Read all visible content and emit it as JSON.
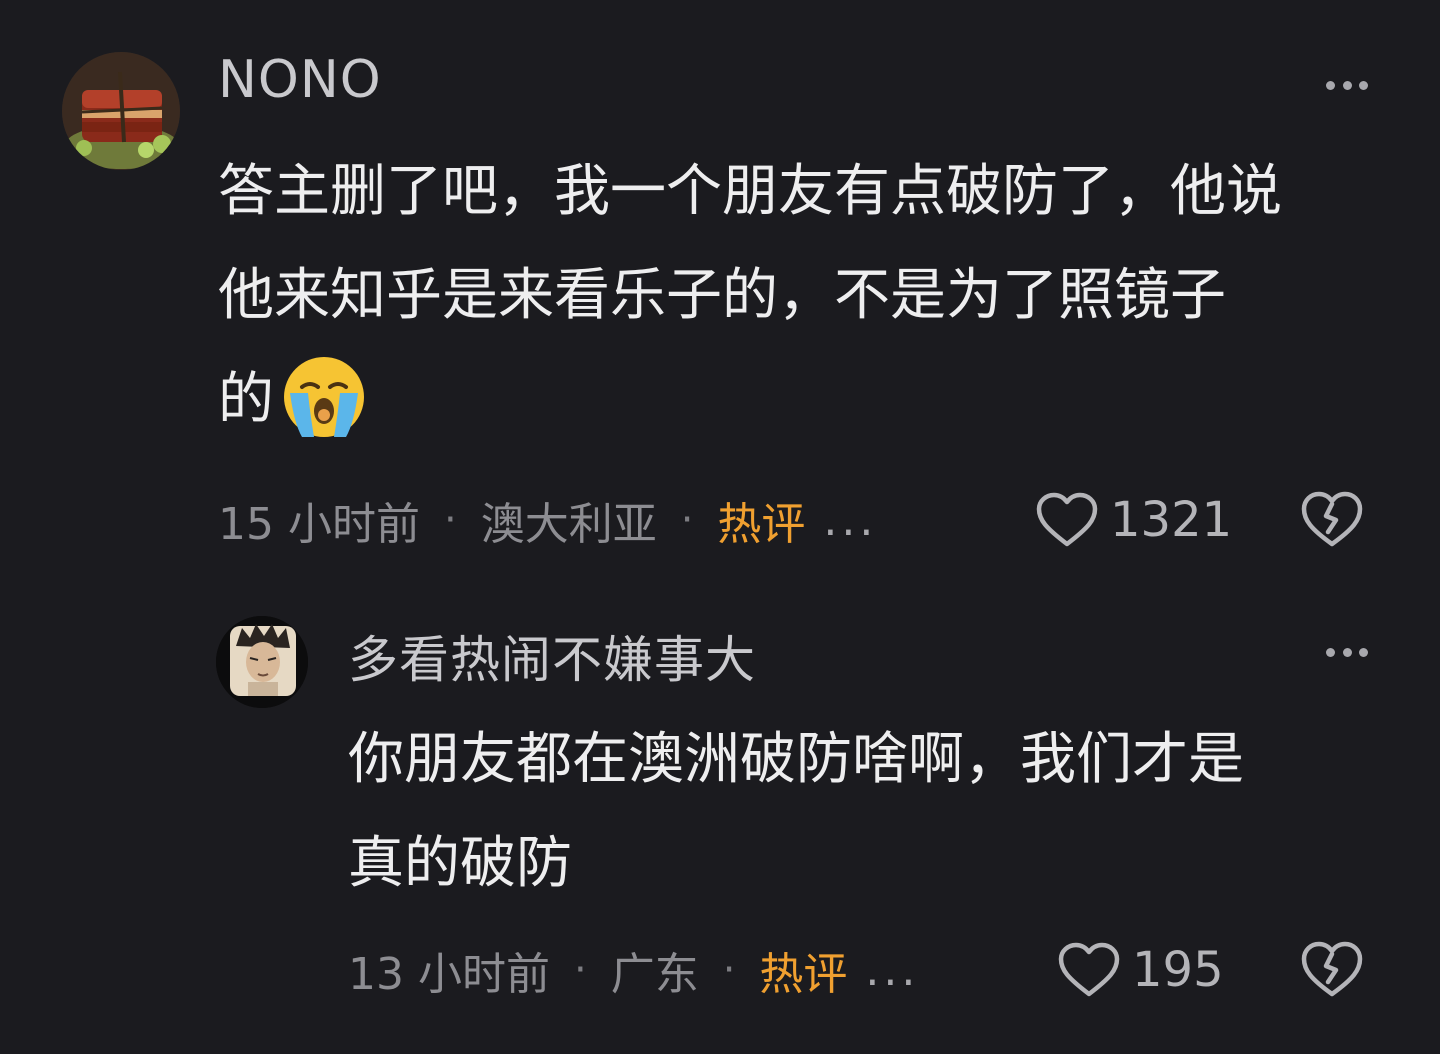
{
  "comments": [
    {
      "author": "NONO",
      "avatar_icon": "braised-pork-avatar",
      "text_lines": [
        "答主删了吧，我一个朋友有点破防了，他说",
        "他来知乎是来看乐子的，不是为了照镜子",
        "的"
      ],
      "emoji": "loudly-crying-face",
      "time": "15 小时前",
      "location": "澳大利亚",
      "tag": "热评",
      "ellipsis": "...",
      "likes": "1321"
    },
    {
      "author": "多看热闹不嫌事大",
      "avatar_icon": "anime-character-avatar",
      "text_lines": [
        "你朋友都在澳洲破防啥啊，我们才是",
        "真的破防"
      ],
      "time": "13 小时前",
      "location": "广东",
      "tag": "热评",
      "ellipsis": "...",
      "likes": "195"
    }
  ],
  "colors": {
    "background": "#1b1b1f",
    "hot_tag": "#f0a030",
    "meta_text": "#8d8d92"
  }
}
